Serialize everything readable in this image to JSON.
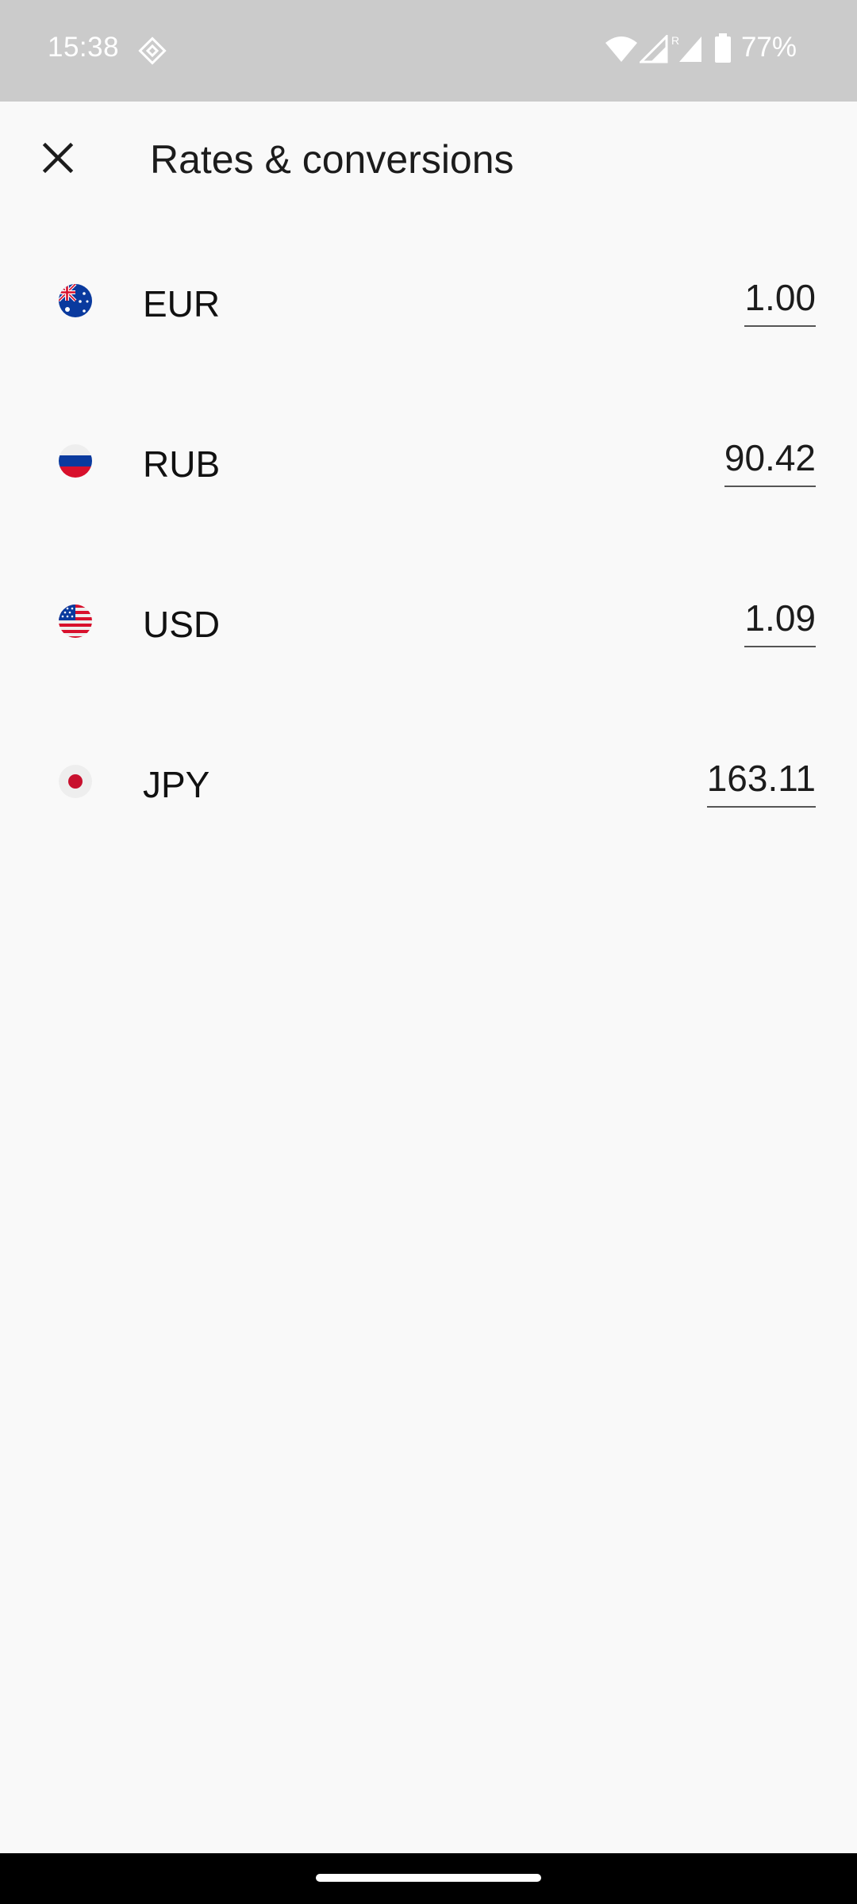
{
  "status_bar": {
    "time": "15:38",
    "battery_percent": "77%",
    "icons": [
      "sync-diamond-icon",
      "wifi-icon",
      "signal-icon",
      "roaming-signal-icon",
      "battery-icon"
    ]
  },
  "app_bar": {
    "title": "Rates & conversions",
    "close_icon": "close-icon"
  },
  "currencies": [
    {
      "code": "EUR",
      "value": "1.00",
      "flag_icon": "flag-australia-icon"
    },
    {
      "code": "RUB",
      "value": "90.42",
      "flag_icon": "flag-russia-icon"
    },
    {
      "code": "USD",
      "value": "1.09",
      "flag_icon": "flag-usa-icon"
    },
    {
      "code": "JPY",
      "value": "163.11",
      "flag_icon": "flag-japan-icon"
    }
  ],
  "colors": {
    "background": "#f9f9f9",
    "status_bar": "#cbcbcb",
    "text_primary": "#1c1c1c"
  }
}
